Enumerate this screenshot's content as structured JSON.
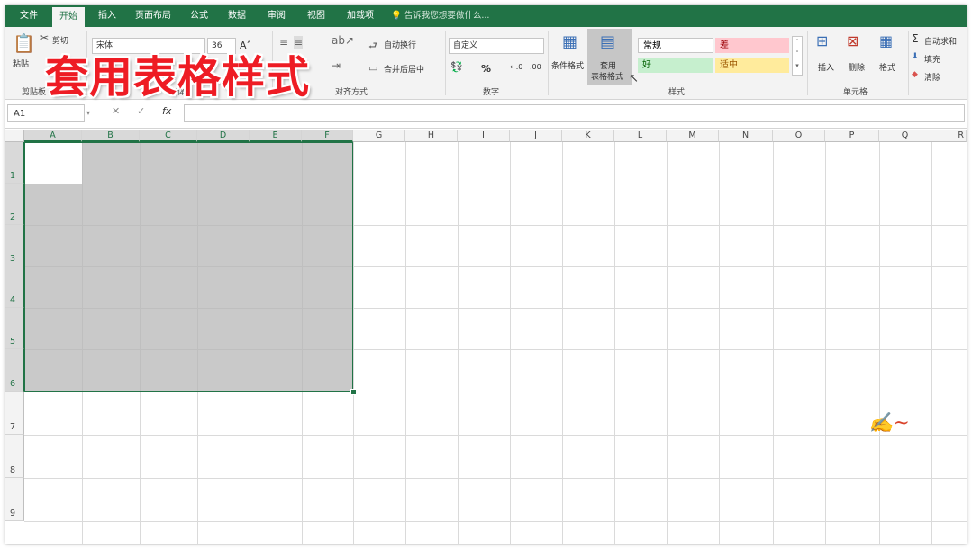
{
  "tabs": [
    "文件",
    "开始",
    "插入",
    "页面布局",
    "公式",
    "数据",
    "审阅",
    "视图",
    "加载项"
  ],
  "active_tab": "开始",
  "tell_me": "告诉我您想要做什么...",
  "clipboard": {
    "cut": "剪切",
    "paste": "粘贴",
    "group": "剪贴板"
  },
  "font": {
    "name": "宋体",
    "size": "36",
    "group": "字体"
  },
  "alignment": {
    "wrap": "自动换行",
    "merge": "合并后居中",
    "group": "对齐方式"
  },
  "number": {
    "format": "自定义",
    "percent": "%",
    "group": "数字"
  },
  "styles": {
    "conditional": "条件格式",
    "table_format_1": "套用",
    "table_format_2": "表格格式",
    "normal": "常规",
    "bad": "差",
    "good": "好",
    "neutral": "适中",
    "group": "样式"
  },
  "cells": {
    "insert": "插入",
    "delete": "删除",
    "format": "格式",
    "group": "单元格"
  },
  "editing": {
    "autosum": "自动求和",
    "fill": "填充",
    "clear": "清除"
  },
  "overlay_title": "套用表格样式",
  "name_box": "A1",
  "columns": [
    "A",
    "B",
    "C",
    "D",
    "E",
    "F",
    "G",
    "H",
    "I",
    "J",
    "K",
    "L",
    "M",
    "N",
    "O",
    "P",
    "Q",
    "R"
  ],
  "rows": [
    "1",
    "2",
    "3",
    "4",
    "5",
    "6",
    "7",
    "8",
    "9"
  ],
  "colors": {
    "accent": "#217346",
    "bad_bg": "#ffc7ce",
    "good_bg": "#c6efce",
    "neutral_bg": "#ffeb9c",
    "overlay": "#ee1c24"
  }
}
